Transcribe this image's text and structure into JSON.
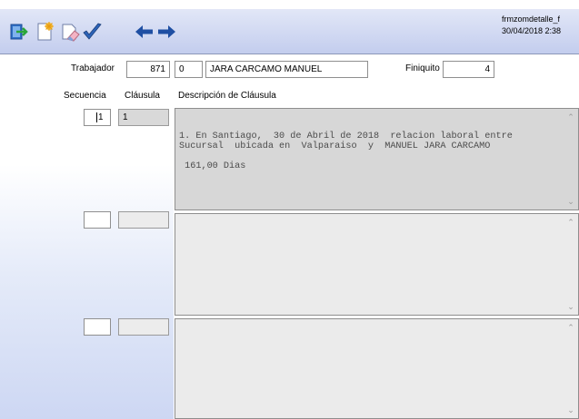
{
  "form": {
    "name": "frmzomdetalle_f",
    "timestamp": "30/04/2018 2:38"
  },
  "toolbar": {
    "icons": [
      "exit-icon",
      "new-record-icon",
      "clear-icon",
      "accept-check-icon",
      "arrow-left-icon",
      "arrow-right-icon"
    ]
  },
  "header": {
    "trabajador_label": "Trabajador",
    "trabajador_value": "871",
    "dv_value": "0",
    "nombre_value": "JARA CARCAMO MANUEL",
    "finiquito_label": "Finiquito",
    "finiquito_value": "4"
  },
  "columns": {
    "secuencia": "Secuencia",
    "clausula": "Cláusula",
    "descripcion": "Descripción de Cláusula"
  },
  "rows": [
    {
      "secuencia": "1",
      "clausula": "1",
      "descripcion": "1. En Santiago,  30 de Abril de 2018  relacion laboral entre\nSucursal  ubicada en  Valparaiso  y  MANUEL JARA CARCAMO\n\n 161,00 Dias"
    },
    {
      "secuencia": "",
      "clausula": "",
      "descripcion": ""
    },
    {
      "secuencia": "",
      "clausula": "",
      "descripcion": ""
    }
  ],
  "colors": {
    "toolbar_top": "#e2e7f7",
    "toolbar_bottom": "#c3cdee",
    "arrow_blue": "#1f4fa3",
    "check_blue": "#2d63b8",
    "memo_gray": "#d7d7d7"
  }
}
